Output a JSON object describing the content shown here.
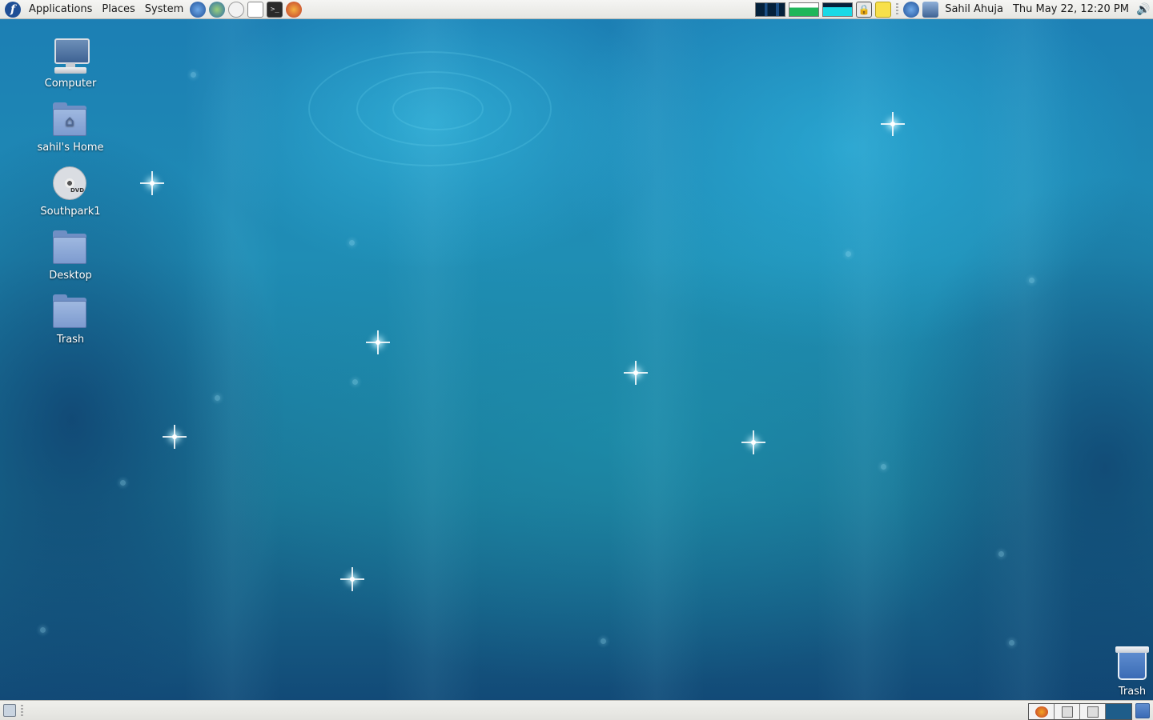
{
  "top_panel": {
    "menus": [
      "Applications",
      "Places",
      "System"
    ],
    "launchers": [
      "firefox-icon",
      "network-globe-icon",
      "mail-clock-icon",
      "text-editor-icon",
      "terminal-icon",
      "help-shell-icon"
    ],
    "tray_icons": [
      "cpu-monitor",
      "memory-monitor",
      "network-monitor",
      "lock-icon",
      "notes-icon",
      "update-icon",
      "network-manager-icon"
    ],
    "user_name": "Sahil Ahuja",
    "clock": "Thu May 22, 12:20 PM",
    "volume_icon": "volume-icon"
  },
  "desktop_icons": [
    {
      "label": "Computer",
      "icon": "computer-icon"
    },
    {
      "label": "sahil's Home",
      "icon": "home-folder-icon"
    },
    {
      "label": "Southpark1",
      "icon": "dvd-icon",
      "badge": "DVD"
    },
    {
      "label": "Desktop",
      "icon": "folder-icon"
    },
    {
      "label": "Trash",
      "icon": "folder-icon"
    }
  ],
  "trash_corner": {
    "label": "Trash",
    "icon": "trash-icon"
  },
  "bottom_panel": {
    "show_desktop_icon": "show-desktop-icon",
    "workspaces": 4,
    "active_workspace": 4
  }
}
